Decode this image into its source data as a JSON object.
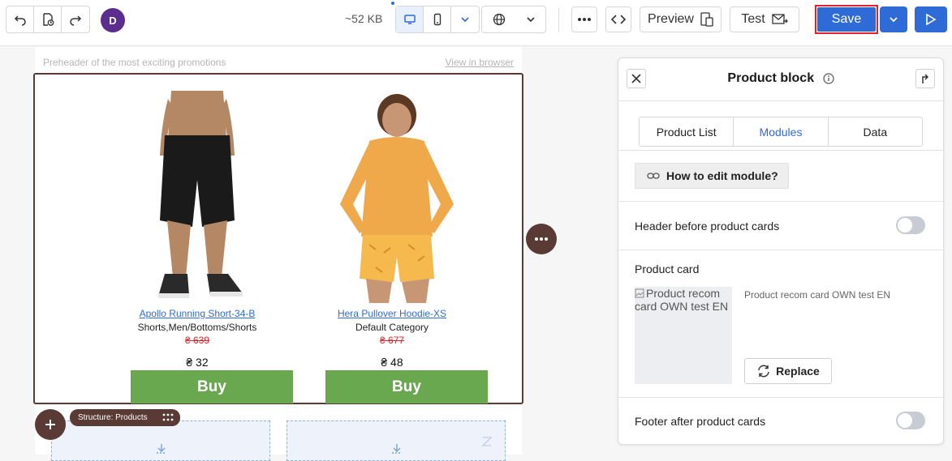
{
  "toolbar": {
    "undo_icon": "undo-icon",
    "history_icon": "history-icon",
    "redo_icon": "redo-icon",
    "avatar_initial": "D",
    "size_label": "~52 KB",
    "desktop_icon": "desktop-icon",
    "mobile_icon": "mobile-icon",
    "language_icon": "globe-icon",
    "more_icon": "more-dots-icon",
    "code_icon": "code-icon",
    "preview_label": "Preview",
    "test_label": "Test",
    "save_label": "Save",
    "accent_color": "#2f6bd6",
    "highlight_color": "#e0232a"
  },
  "email": {
    "preheader": "Preheader of the most exciting promotions",
    "view_in_browser": "View in browser",
    "products": [
      {
        "name": "Apollo Running Short-34-B",
        "category": "Shorts,Men/Bottoms/Shorts",
        "old_price": "₴ 639",
        "price": "₴ 32",
        "buy_label": "Buy"
      },
      {
        "name": "Hera Pullover Hoodie-XS",
        "category": "Default Category",
        "old_price": "₴ 677",
        "price": "₴ 48",
        "buy_label": "Buy"
      }
    ],
    "button_color": "#6aa84f",
    "structure_tag": "Structure: Products",
    "block_accent": "#5a3a34"
  },
  "panel": {
    "title": "Product block",
    "tabs": [
      "Product List",
      "Modules",
      "Data"
    ],
    "active_tab": "Modules",
    "how_to_label": "How to edit module?",
    "header_toggle_label": "Header before product cards",
    "product_card_label": "Product card",
    "card_thumb_alt": "Product recom card OWN test EN",
    "card_name": "Product recom card OWN test EN",
    "replace_label": "Replace",
    "footer_toggle_label": "Footer after product cards"
  }
}
